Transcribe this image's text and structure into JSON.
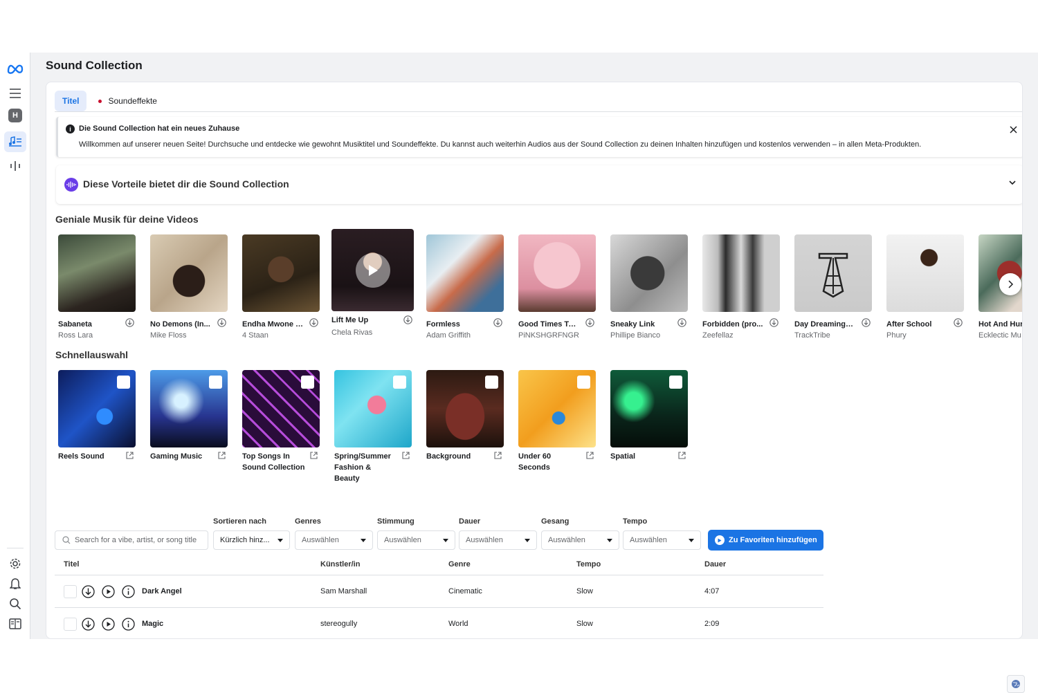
{
  "page": {
    "title": "Sound Collection"
  },
  "tabs": [
    {
      "label": "Titel"
    },
    {
      "label": "Soundeffekte"
    }
  ],
  "notice": {
    "title": "Die Sound Collection hat ein neues Zuhause",
    "body": "Willkommen auf unserer neuen Seite! Durchsuche und entdecke wie gewohnt Musiktitel und Soundeffekte. Du kannst auch weiterhin Audios aus der Sound Collection zu deinen Inhalten hinzufügen und kostenlos verwenden – in allen Meta-Produkten."
  },
  "benefits": {
    "title": "Diese Vorteile bietet dir die Sound Collection"
  },
  "rail": {
    "avatar_letter": "H"
  },
  "featured": {
    "title": "Geniale Musik für deine Videos",
    "items": [
      {
        "name": "Sabaneta",
        "artist": "Ross Lara"
      },
      {
        "name": "No Demons (In...",
        "artist": "Mike Floss"
      },
      {
        "name": "Endha Mwone (...",
        "artist": "4 Staan"
      },
      {
        "name": "Lift Me Up",
        "artist": "Chela Rivas"
      },
      {
        "name": "Formless",
        "artist": "Adam Griffith"
      },
      {
        "name": "Good Times To...",
        "artist": "PiNKSHGRFNGR"
      },
      {
        "name": "Sneaky Link",
        "artist": "Phillipe Bianco"
      },
      {
        "name": "Forbidden (pro...",
        "artist": "Zeefellaz"
      },
      {
        "name": "Day Dreaming I...",
        "artist": "TrackTribe"
      },
      {
        "name": "After School",
        "artist": "Phury"
      },
      {
        "name": "Hot And Hur",
        "artist": "Ecklectic Mu"
      }
    ]
  },
  "quickpicks": {
    "title": "Schnellauswahl",
    "items": [
      {
        "name": "Reels Sound"
      },
      {
        "name": "Gaming Music"
      },
      {
        "name": "Top Songs In Sound Collection"
      },
      {
        "name": "Spring/Summer Fashion & Beauty"
      },
      {
        "name": "Background"
      },
      {
        "name": "Under 60 Seconds"
      },
      {
        "name": "Spatial"
      }
    ]
  },
  "filters": {
    "search_placeholder": "Search for a vibe, artist, or song title",
    "sort": {
      "label": "Sortieren nach",
      "value": "Kürzlich hinz..."
    },
    "genres": {
      "label": "Genres",
      "value": "Auswählen"
    },
    "mood": {
      "label": "Stimmung",
      "value": "Auswählen"
    },
    "duration": {
      "label": "Dauer",
      "value": "Auswählen"
    },
    "vocals": {
      "label": "Gesang",
      "value": "Auswählen"
    },
    "tempo": {
      "label": "Tempo",
      "value": "Auswählen"
    },
    "favorites_button": "Zu Favoriten hinzufügen"
  },
  "table": {
    "headers": {
      "title": "Titel",
      "artist": "Künstler/in",
      "genre": "Genre",
      "tempo": "Tempo",
      "duration": "Dauer"
    },
    "rows": [
      {
        "title": "Dark Angel",
        "artist": "Sam Marshall",
        "genre": "Cinematic",
        "tempo": "Slow",
        "duration": "4:07"
      },
      {
        "title": "Magic",
        "artist": "stereogully",
        "genre": "World",
        "tempo": "Slow",
        "duration": "2:09"
      }
    ]
  },
  "colors": {
    "accent": "#1b74e4",
    "benefits_icon": "#6a3de8",
    "tab_dot": "#c8102e"
  },
  "icons": [
    "meta-logo-icon",
    "menu-icon",
    "music-library-icon",
    "audio-bars-icon",
    "settings-icon",
    "bell-icon",
    "search-icon",
    "panel-icon",
    "info-icon",
    "close-icon",
    "chevron-down-icon",
    "download-icon",
    "external-link-icon",
    "play-icon",
    "globe-icon"
  ]
}
